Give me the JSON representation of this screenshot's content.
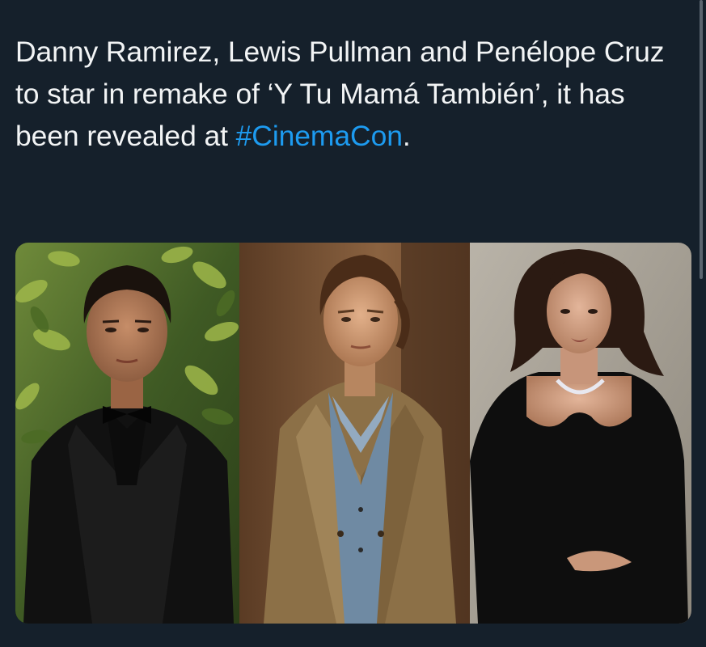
{
  "tweet": {
    "text_before_hashtag": "Danny Ramirez, Lewis Pullman and Penélope Cruz to star in remake of ‘Y Tu Mamá También’, it has been revealed at ",
    "hashtag": "#CinemaCon",
    "text_after_hashtag": "."
  },
  "media": {
    "photos": [
      {
        "alt": "Danny Ramirez",
        "description": "man in black tuxedo and bow tie against green leaves"
      },
      {
        "alt": "Lewis Pullman",
        "description": "man in tan jacket and denim shirt"
      },
      {
        "alt": "Penélope Cruz",
        "description": "woman in black dress with diamond necklace"
      }
    ]
  },
  "colors": {
    "background": "#15202b",
    "text": "#f2f4f5",
    "hashtag": "#1d9bf0"
  }
}
